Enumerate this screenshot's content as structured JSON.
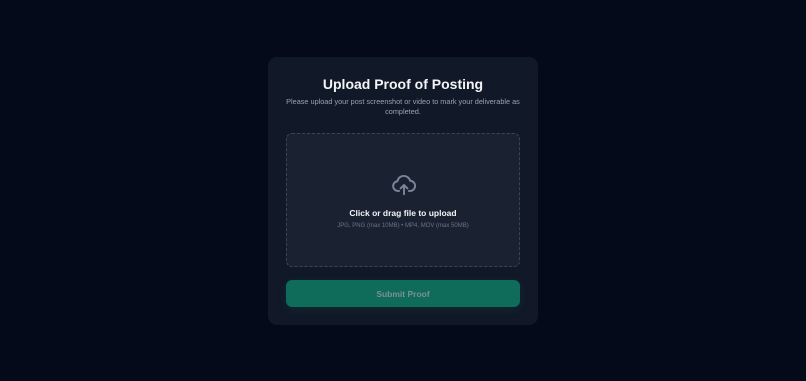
{
  "dialog": {
    "title": "Upload Proof of Posting",
    "subtitle": "Please upload your post screenshot or video to mark your deliverable as completed."
  },
  "dropzone": {
    "icon": "cloud-upload-icon",
    "label": "Click or drag file to upload",
    "hint": "JPG, PNG (max 10MB) • MP4, MOV (max 50MB)"
  },
  "submit": {
    "label": "Submit Proof",
    "enabled": false
  },
  "colors": {
    "background": "#050a1b",
    "card": "#111827",
    "dropzone": "#1a2232",
    "accent": "#0f6b5a"
  }
}
